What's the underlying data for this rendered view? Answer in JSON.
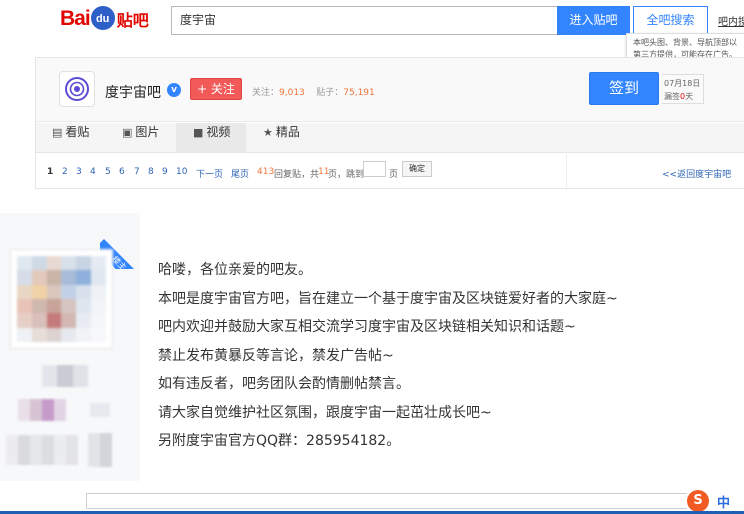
{
  "brand": {
    "logo_bai": "Bai",
    "logo_du": "du",
    "logo_tieba": "贴吧"
  },
  "search": {
    "query": "度宇宙",
    "enter_button": "进入贴吧",
    "search_all_button": "全吧搜索",
    "help_link": "吧内搜"
  },
  "tooltip": {
    "line1": "本吧头图、背景、导航顶部以",
    "line2": "第三方提供，可能存在广告。"
  },
  "forum": {
    "name": "度宇宙吧",
    "verified_icon": "v",
    "follow_button": "+ 关注",
    "followers_label": "关注：",
    "followers_value": "9,013",
    "posts_label": "贴子：",
    "posts_value": "75,191",
    "sign_button": "签到",
    "sign_date": "07月18日",
    "missed_label": "漏签",
    "missed_count": "0",
    "missed_unit": "天",
    "avatar_icon": "planet-ring-icon"
  },
  "tabs": [
    {
      "label": "看贴",
      "icon": "document-icon"
    },
    {
      "label": "图片",
      "icon": "image-icon"
    },
    {
      "label": "视频",
      "icon": "video-icon"
    },
    {
      "label": "精品",
      "icon": "star-icon"
    }
  ],
  "pager": {
    "pages": [
      "1",
      "2",
      "3",
      "4",
      "5",
      "6",
      "7",
      "8",
      "9",
      "10"
    ],
    "next": "下一页",
    "last": "尾页",
    "replies_count": "413",
    "replies_text": "回复贴，共",
    "page_count": "11",
    "page_text": "页，跳到",
    "page_unit": "页",
    "confirm": "确定",
    "back_link": "<<返回度宇宙吧"
  },
  "post": {
    "owner_badge": "楼主",
    "lines": [
      "哈喽，各位亲爱的吧友。",
      "本吧是度宇宙官方吧，旨在建立一个基于度宇宙及区块链爱好者的大家庭~",
      "吧内欢迎并鼓励大家互相交流学习度宇宙及区块链相关知识和话题~",
      "禁止发布黄暴反等言论，禁发广告帖~",
      "如有违反者，吧务团队会酌情删帖禁言。",
      "请大家自觉维护社区氛围，跟度宇宙一起茁壮成长吧~",
      "另附度宇宙官方QQ群：285954182。"
    ]
  },
  "ime": {
    "logo": "S",
    "mode": "中"
  },
  "colors": {
    "accent_blue": "#3385ff",
    "brand_red": "#e10601",
    "follow_red": "#f25a5a",
    "stat_orange": "#f0763a"
  }
}
